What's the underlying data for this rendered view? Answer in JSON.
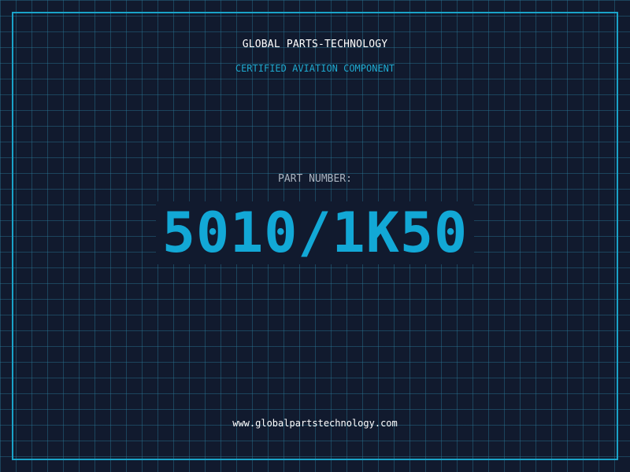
{
  "header": {
    "title": "GLOBAL PARTS-TECHNOLOGY",
    "subtitle": "CERTIFIED AVIATION COMPONENT"
  },
  "part": {
    "label": "PART NUMBER:",
    "number": "5010/1K50"
  },
  "footer": {
    "website": "www.globalpartstechnology.com"
  },
  "colors": {
    "background": "#111a2e",
    "grid": "#297896",
    "frame": "#1aa3c8",
    "accent": "#12a8d6",
    "title": "#ffffff",
    "label": "#aab4c0"
  }
}
